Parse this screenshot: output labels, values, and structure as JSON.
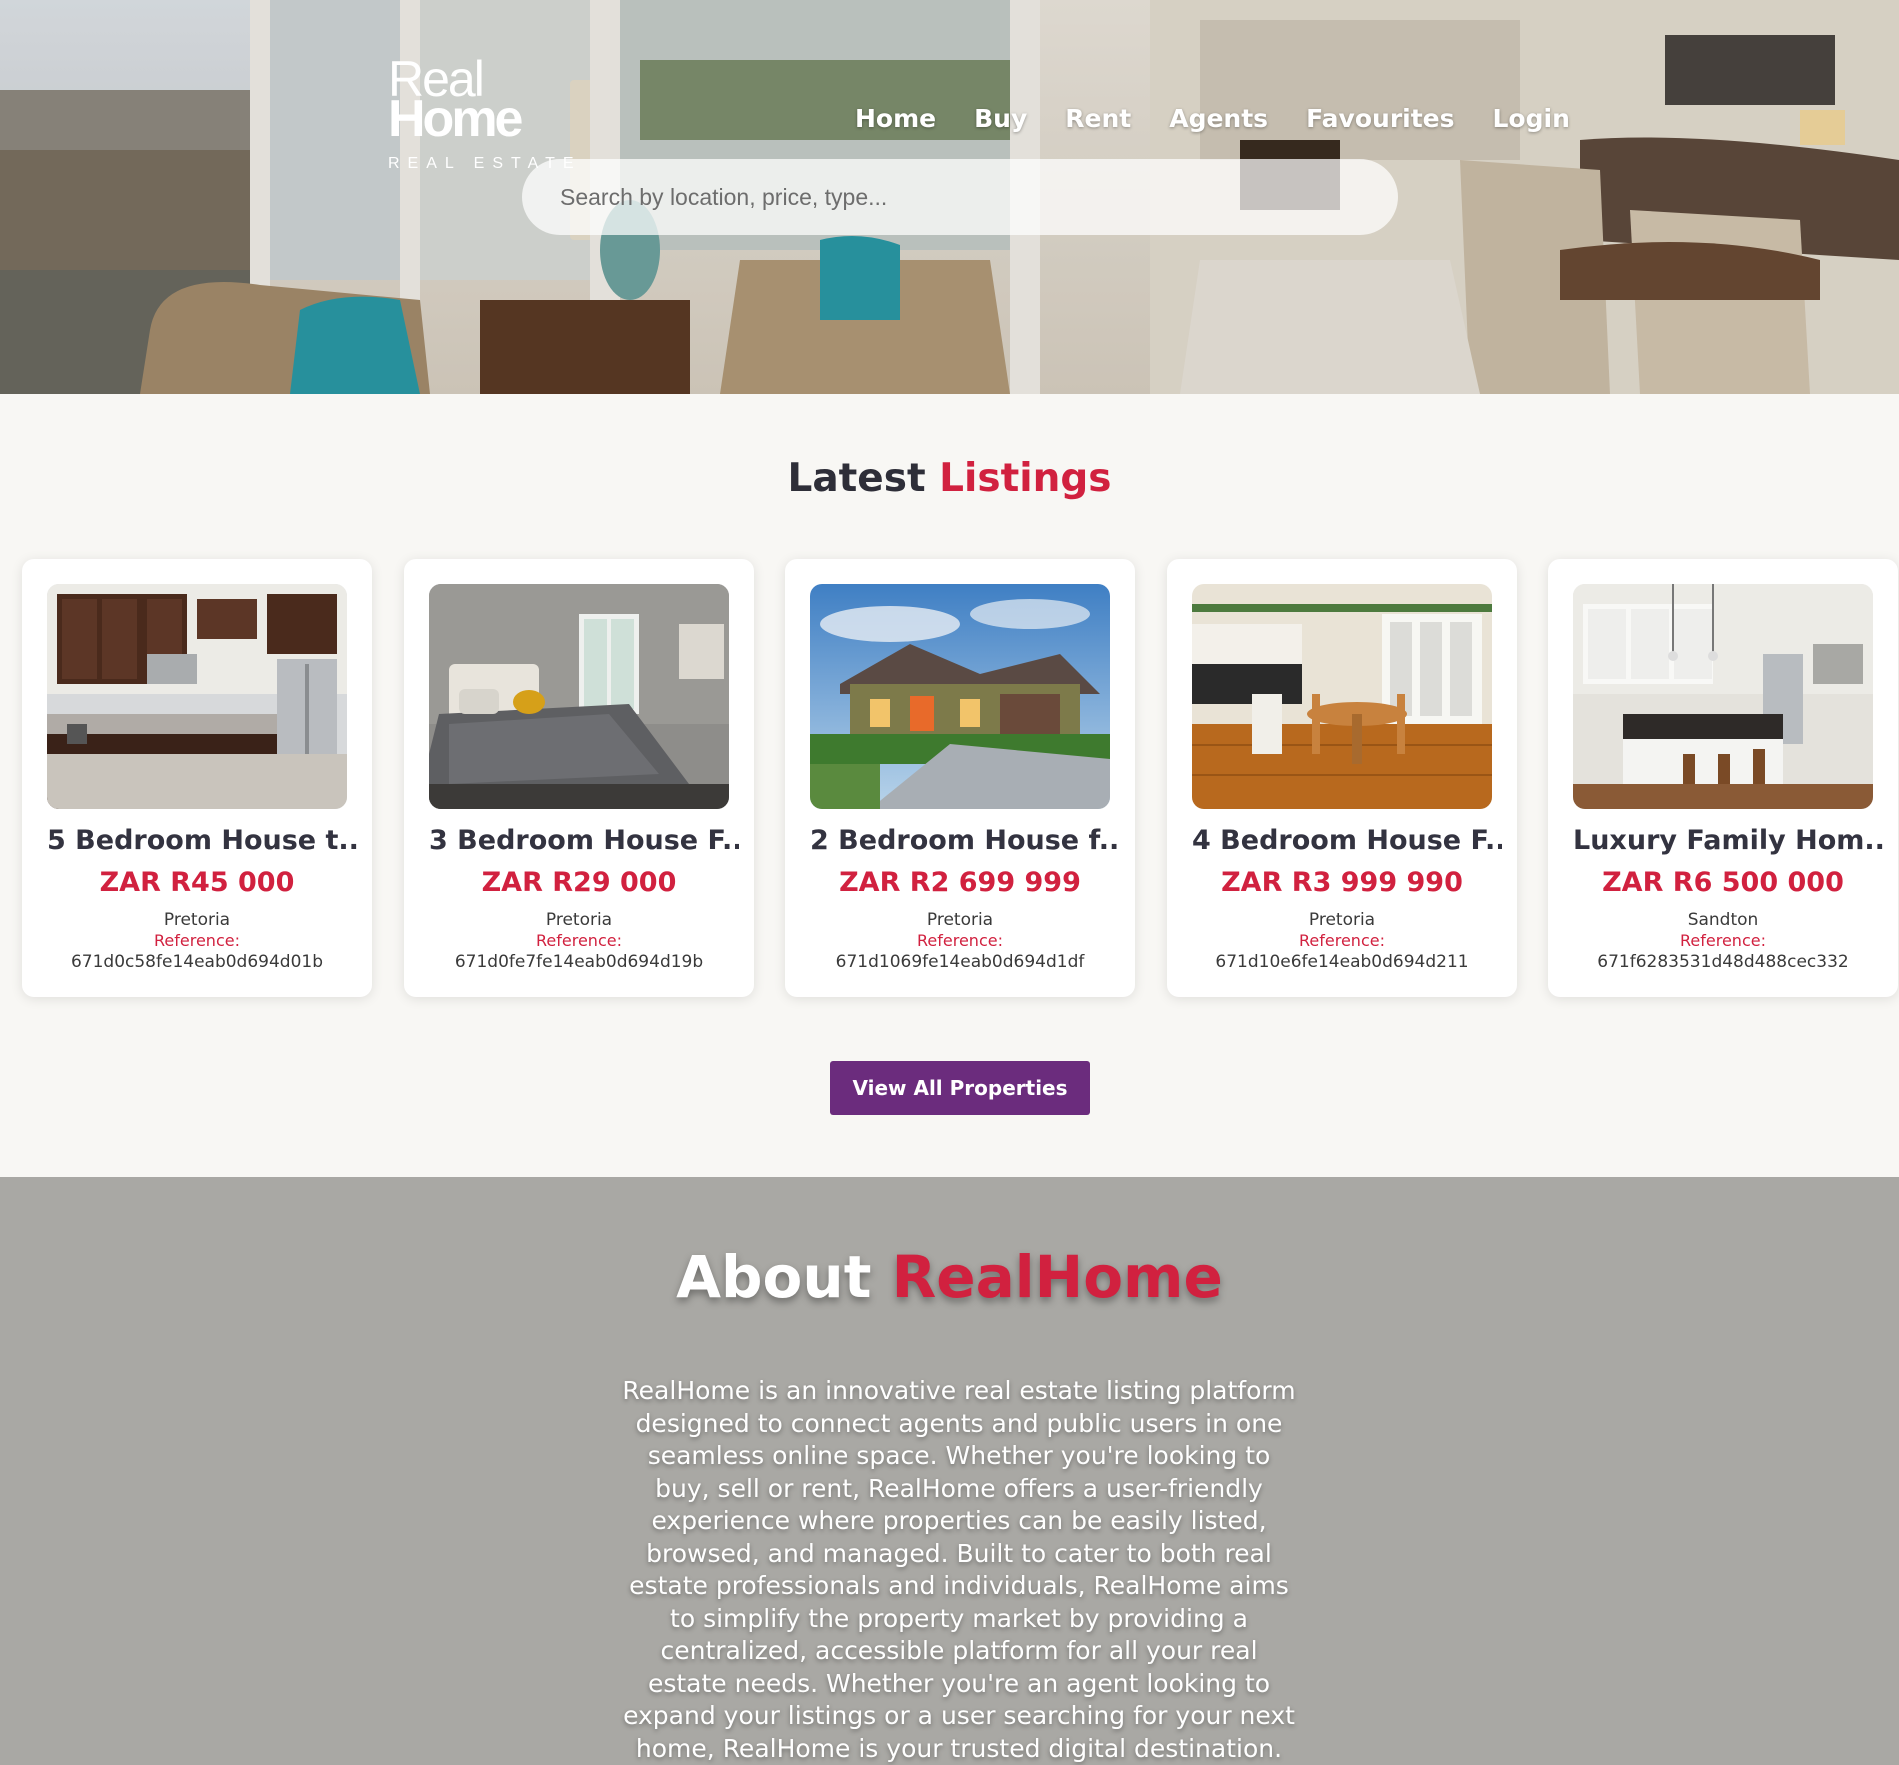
{
  "brand": {
    "logo_line1": "Real",
    "logo_line2": "Home",
    "logo_tagline": "REAL ESTATE"
  },
  "nav": {
    "items": [
      "Home",
      "Buy",
      "Rent",
      "Agents",
      "Favourites",
      "Login"
    ]
  },
  "search": {
    "placeholder": "Search by location, price, type..."
  },
  "listings": {
    "title_part1": "Latest",
    "title_part2": "Listings",
    "cards": [
      {
        "title": "5 Bedroom House t...",
        "price": "ZAR R45 000",
        "location": "Pretoria",
        "reference_label": "Reference:",
        "reference": "671d0c58fe14eab0d694d01b",
        "image": "kitchen-photo"
      },
      {
        "title": "3 Bedroom House F...",
        "price": "ZAR R29 000",
        "location": "Pretoria",
        "reference_label": "Reference:",
        "reference": "671d0fe7fe14eab0d694d19b",
        "image": "bedroom-photo"
      },
      {
        "title": "2 Bedroom House f...",
        "price": "ZAR R2 699 999",
        "location": "Pretoria",
        "reference_label": "Reference:",
        "reference": "671d1069fe14eab0d694d1df",
        "image": "house-exterior-photo"
      },
      {
        "title": "4 Bedroom House F...",
        "price": "ZAR R3 999 990",
        "location": "Pretoria",
        "reference_label": "Reference:",
        "reference": "671d10e6fe14eab0d694d211",
        "image": "dining-room-photo"
      },
      {
        "title": "Luxury Family Hom...",
        "price": "ZAR R6 500 000",
        "location": "Sandton",
        "reference_label": "Reference:",
        "reference": "671f6283531d48d488cec332",
        "image": "kitchen-island-photo"
      }
    ],
    "view_all_label": "View All Properties"
  },
  "about": {
    "title_part1": "About",
    "title_part2": "RealHome",
    "text": "RealHome is an innovative real estate listing platform designed to connect agents and public users in one seamless online space. Whether you're looking to buy, sell or rent, RealHome offers a user-friendly experience where properties can be easily listed, browsed, and managed. Built to cater to both real estate professionals and individuals, RealHome aims to simplify the property market by providing a centralized, accessible platform for all your real estate needs. Whether you're an agent looking to expand your listings or a user searching for your next home, RealHome is your trusted digital destination."
  },
  "colors": {
    "accent_red": "#d1213f",
    "button_purple": "#6b2c7d",
    "about_bg": "#a9a8a4",
    "page_bg": "#f8f7f4"
  }
}
